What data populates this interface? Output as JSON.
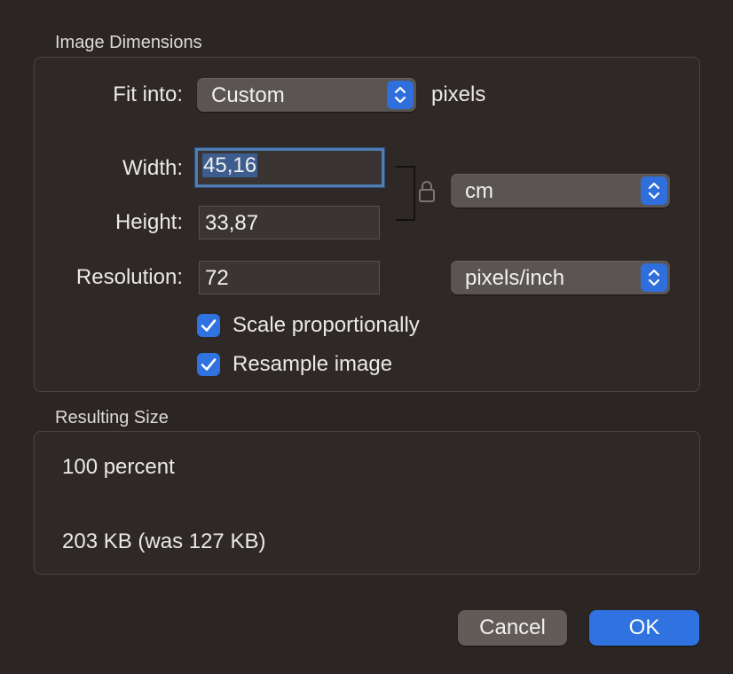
{
  "image_dimensions": {
    "title": "Image Dimensions",
    "fit_into": {
      "label": "Fit into:",
      "value": "Custom",
      "unit_label": "pixels"
    },
    "width": {
      "label": "Width:",
      "value": "45,16"
    },
    "height": {
      "label": "Height:",
      "value": "33,87"
    },
    "unit_select": {
      "value": "cm"
    },
    "resolution": {
      "label": "Resolution:",
      "value": "72",
      "unit": "pixels/inch"
    },
    "scale_proportionally": {
      "label": "Scale proportionally",
      "checked": true
    },
    "resample_image": {
      "label": "Resample image",
      "checked": true
    }
  },
  "resulting_size": {
    "title": "Resulting Size",
    "percent": "100 percent",
    "file_size": "203 KB (was 127 KB)"
  },
  "buttons": {
    "cancel": "Cancel",
    "ok": "OK"
  },
  "colors": {
    "accent": "#2f72e0",
    "background": "#2b2624",
    "focus_ring": "#4f7db4"
  },
  "icons": {
    "lock": "lock-icon",
    "checkmark": "checkmark-icon",
    "stepper": "up-down-chevron-icon"
  }
}
